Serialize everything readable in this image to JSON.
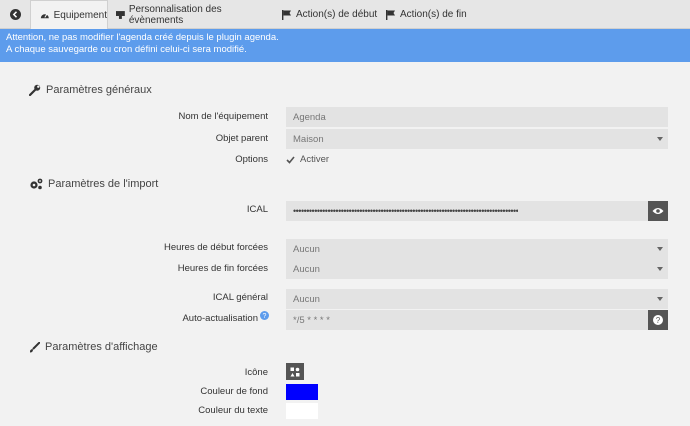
{
  "tabs": [
    {
      "label": ""
    },
    {
      "label": "Equipement"
    },
    {
      "label": "Personnalisation des évènements"
    },
    {
      "label": "Action(s) de début"
    },
    {
      "label": "Action(s) de fin"
    }
  ],
  "alert": {
    "line1": "Attention, ne pas modifier l'agenda créé depuis le plugin agenda.",
    "line2": "A chaque sauvegarde ou cron défini celui-ci sera modifié."
  },
  "general": {
    "title": "Paramètres généraux",
    "name_label": "Nom de l'équipement",
    "name_value": "Agenda",
    "parent_label": "Objet parent",
    "parent_value": "Maison",
    "options_label": "Options",
    "activer_label": "Activer"
  },
  "import": {
    "title": "Paramètres de l'import",
    "ical_label": "ICAL",
    "ical_value": "•••••••••••••••••••••••••••••••••••••••••••••••••••••••••••••••••••••••••••••••••••••",
    "start_label": "Heures de début forcées",
    "start_value": "Aucun",
    "end_label": "Heures de fin forcées",
    "end_value": "Aucun",
    "general_label": "ICAL général",
    "general_value": "Aucun",
    "auto_label": "Auto-actualisation",
    "auto_value": "*/5 * * * *"
  },
  "display": {
    "title": "Paramètres d'affichage",
    "icon_label": "Icône",
    "bg_label": "Couleur de fond",
    "bg_color": "#0000ff",
    "text_label": "Couleur du texte",
    "text_color": "#ffffff"
  }
}
